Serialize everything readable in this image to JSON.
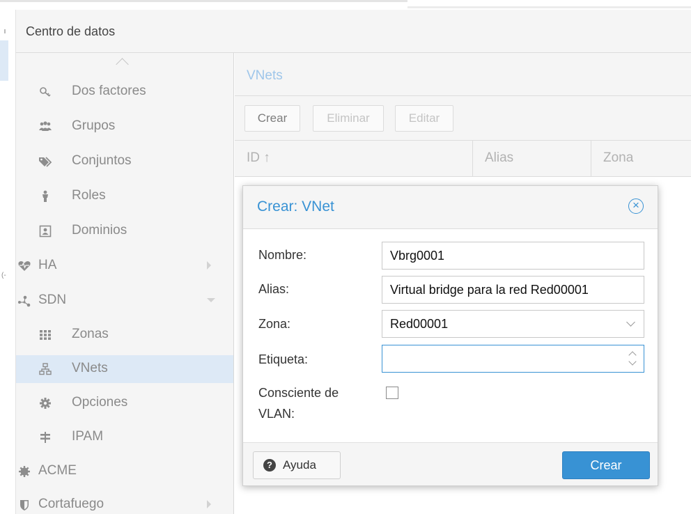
{
  "header": {
    "title": "Centro de datos"
  },
  "nav": {
    "items": [
      {
        "label": "Dos factores",
        "icon": "key-icon"
      },
      {
        "label": "Grupos",
        "icon": "users-icon"
      },
      {
        "label": "Conjuntos",
        "icon": "tags-icon"
      },
      {
        "label": "Roles",
        "icon": "person-icon"
      },
      {
        "label": "Dominios",
        "icon": "id-card-icon"
      },
      {
        "label": "HA",
        "icon": "heartbeat-icon"
      },
      {
        "label": "SDN",
        "icon": "sdn-icon"
      },
      {
        "label": "Zonas",
        "icon": "grid-icon"
      },
      {
        "label": "VNets",
        "icon": "network-icon"
      },
      {
        "label": "Opciones",
        "icon": "gear-icon"
      },
      {
        "label": "IPAM",
        "icon": "signpost-icon"
      },
      {
        "label": "ACME",
        "icon": "certificate-icon"
      },
      {
        "label": "Cortafuego",
        "icon": "shield-icon"
      }
    ]
  },
  "panel": {
    "title": "VNets",
    "toolbar": {
      "create": "Crear",
      "delete": "Eliminar",
      "edit": "Editar"
    },
    "columns": [
      "ID ↑",
      "Alias",
      "Zona"
    ]
  },
  "dialog": {
    "title": "Crear: VNet",
    "fields": {
      "name_label": "Nombre:",
      "name_value": "Vbrg0001",
      "alias_label": "Alias:",
      "alias_value": "Virtual bridge para la red Red00001",
      "zone_label": "Zona:",
      "zone_value": "Red00001",
      "tag_label": "Etiqueta:",
      "tag_value": "",
      "vlan_label_line1": "Consciente de",
      "vlan_label_line2": "VLAN:",
      "vlan_checked": false
    },
    "help_label": "Ayuda",
    "create_label": "Crear"
  },
  "colors": {
    "accent": "#3892d4",
    "selected_bg": "#dde9f6",
    "panel_bg": "#f5f5f5"
  }
}
